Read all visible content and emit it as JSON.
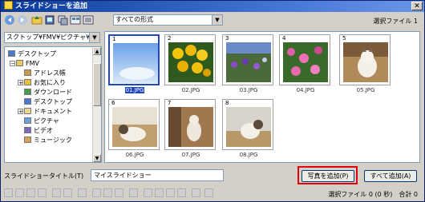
{
  "window": {
    "title": "スライドショーを追加",
    "close_label": "✕"
  },
  "toolbar": {
    "filter_value": "すべての形式",
    "selection_count": "選択ファイル 1",
    "icons": [
      "back-arrow-icon",
      "forward-arrow-icon",
      "folder-up-icon",
      "view-icon",
      "copy-icon",
      "large-icons-icon",
      "details-view-icon"
    ]
  },
  "location": {
    "value": "スクトップ¥FMV¥ピクチャ¥"
  },
  "tree": {
    "items": [
      {
        "label": "デスクトップ",
        "icon": "desktop-icon",
        "level": 0
      },
      {
        "label": "FMV",
        "icon": "user-folder-icon",
        "level": 1,
        "expander": "−"
      },
      {
        "label": "アドレス帳",
        "icon": "address-book-icon",
        "level": 2
      },
      {
        "label": "お気に入り",
        "icon": "favorites-icon",
        "level": 2,
        "expander": "+"
      },
      {
        "label": "ダウンロード",
        "icon": "downloads-icon",
        "level": 2
      },
      {
        "label": "デスクトップ",
        "icon": "desktop-icon",
        "level": 2
      },
      {
        "label": "ドキュメント",
        "icon": "documents-icon",
        "level": 2,
        "expander": "+"
      },
      {
        "label": "ピクチャ",
        "icon": "pictures-icon",
        "level": 2
      },
      {
        "label": "ビデオ",
        "icon": "videos-icon",
        "level": 2
      },
      {
        "label": "ミュージック",
        "icon": "music-icon",
        "level": 2
      }
    ]
  },
  "thumbnails": [
    {
      "num": "1",
      "file": "01.JPG",
      "selected": true
    },
    {
      "num": "2",
      "file": "02.JPG",
      "selected": false
    },
    {
      "num": "3",
      "file": "03.JPG",
      "selected": false
    },
    {
      "num": "4",
      "file": "04.JPG",
      "selected": false
    },
    {
      "num": "5",
      "file": "05.JPG",
      "selected": false
    },
    {
      "num": "6",
      "file": "06.JPG",
      "selected": false
    },
    {
      "num": "7",
      "file": "07.JPG",
      "selected": false
    },
    {
      "num": "8",
      "file": "08.JPG",
      "selected": false
    }
  ],
  "slideshow_title": {
    "label": "スライドショータイトル(T)",
    "value": "マイスライドショー"
  },
  "buttons": {
    "add_photo": "写真を追加(P)",
    "add_all": "すべて追加(A)"
  },
  "status": {
    "text": "選択ファイル 0 (0 秒)　合計 0"
  },
  "colors": {
    "highlight": "#e00010",
    "selection": "#2046c8"
  }
}
